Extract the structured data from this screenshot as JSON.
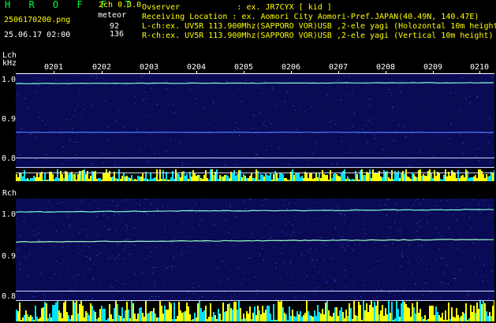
{
  "header": {
    "logo": "H R O F F T",
    "version": "2ch 0.3.0",
    "filename": "2506170200.png",
    "meteor_label": "meteor",
    "meteor_counts": [
      "92",
      "136"
    ],
    "datetime": "25.06.17 02:00"
  },
  "info": {
    "observer": "Ovserver            : ex. JR7CYX [ kid ]",
    "receiving": "Receiving Location : ex. Aomori City Aomori-Pref.JAPAN(40.49N, 140.47E)",
    "lch": "L-ch:ex. UV5R 113.900Mhz(SAPPORO VOR)USB ,2-ele yagi (Holozontal 10m height",
    "rch": "R-ch:ex. UV5R 113.900Mhz(SAPPORO VOR)USB ,2-ele yagi (Vertical 10m height)"
  },
  "axis": {
    "lch_label": "Lch",
    "unit": "kHz",
    "rch_label": "Rch",
    "time_ticks": [
      "0201",
      "0202",
      "0203",
      "0204",
      "0205",
      "0206",
      "0207",
      "0208",
      "0209",
      "0210"
    ],
    "lch_yticks": [
      "1.0",
      "0.9",
      "0.8"
    ],
    "rch_yticks": [
      "1.0",
      "0.9",
      "0.8"
    ]
  },
  "colors": {
    "background": "#000000",
    "spectrum": "#0a0a55",
    "trace": "#7fffd4",
    "bars_yellow": "#ffff00",
    "bars_cyan": "#00e0ff",
    "text_green": "#00ff40",
    "text_yellow": "#ffff00"
  }
}
